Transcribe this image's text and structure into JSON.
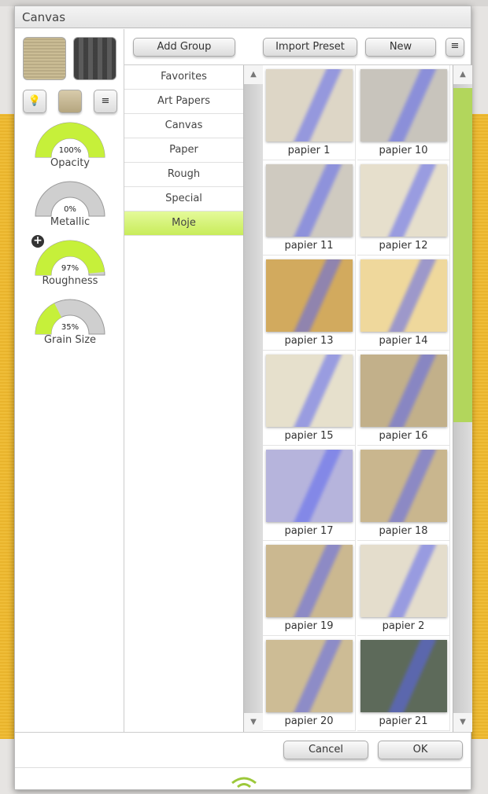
{
  "window": {
    "title": "Canvas"
  },
  "left_panel": {
    "gauges": [
      {
        "label": "Opacity",
        "value": 100,
        "value_text": "100%"
      },
      {
        "label": "Metallic",
        "value": 0,
        "value_text": "0%"
      },
      {
        "label": "Roughness",
        "value": 97,
        "value_text": "97%"
      },
      {
        "label": "Grain Size",
        "value": 35,
        "value_text": "35%"
      }
    ],
    "accent": "#c6f03a"
  },
  "toolbar": {
    "add_group": "Add Group",
    "import_preset": "Import Preset",
    "new": "New"
  },
  "groups": [
    {
      "label": "Favorites"
    },
    {
      "label": "Art Papers"
    },
    {
      "label": "Canvas"
    },
    {
      "label": "Paper"
    },
    {
      "label": "Rough"
    },
    {
      "label": "Special"
    },
    {
      "label": "Moje",
      "selected": true
    }
  ],
  "presets": [
    {
      "name": "papier 1",
      "color": "#ddd6c6"
    },
    {
      "name": "papier 10",
      "color": "#c8c4bc"
    },
    {
      "name": "papier 11",
      "color": "#cfcac0"
    },
    {
      "name": "papier 12",
      "color": "#e6dfcc"
    },
    {
      "name": "papier 13",
      "color": "#d2aa5e"
    },
    {
      "name": "papier 14",
      "color": "#efd89c"
    },
    {
      "name": "papier 15",
      "color": "#e6e0cc"
    },
    {
      "name": "papier 16",
      "color": "#c2b08a"
    },
    {
      "name": "papier 17",
      "color": "#b6b4dc"
    },
    {
      "name": "papier 18",
      "color": "#c9b68e"
    },
    {
      "name": "papier 19",
      "color": "#cbb890"
    },
    {
      "name": "papier 2",
      "color": "#e4ddcc"
    },
    {
      "name": "papier 20",
      "color": "#cdbc95"
    },
    {
      "name": "papier 21",
      "color": "#5d6a5a"
    }
  ],
  "dialog": {
    "cancel": "Cancel",
    "ok": "OK"
  }
}
